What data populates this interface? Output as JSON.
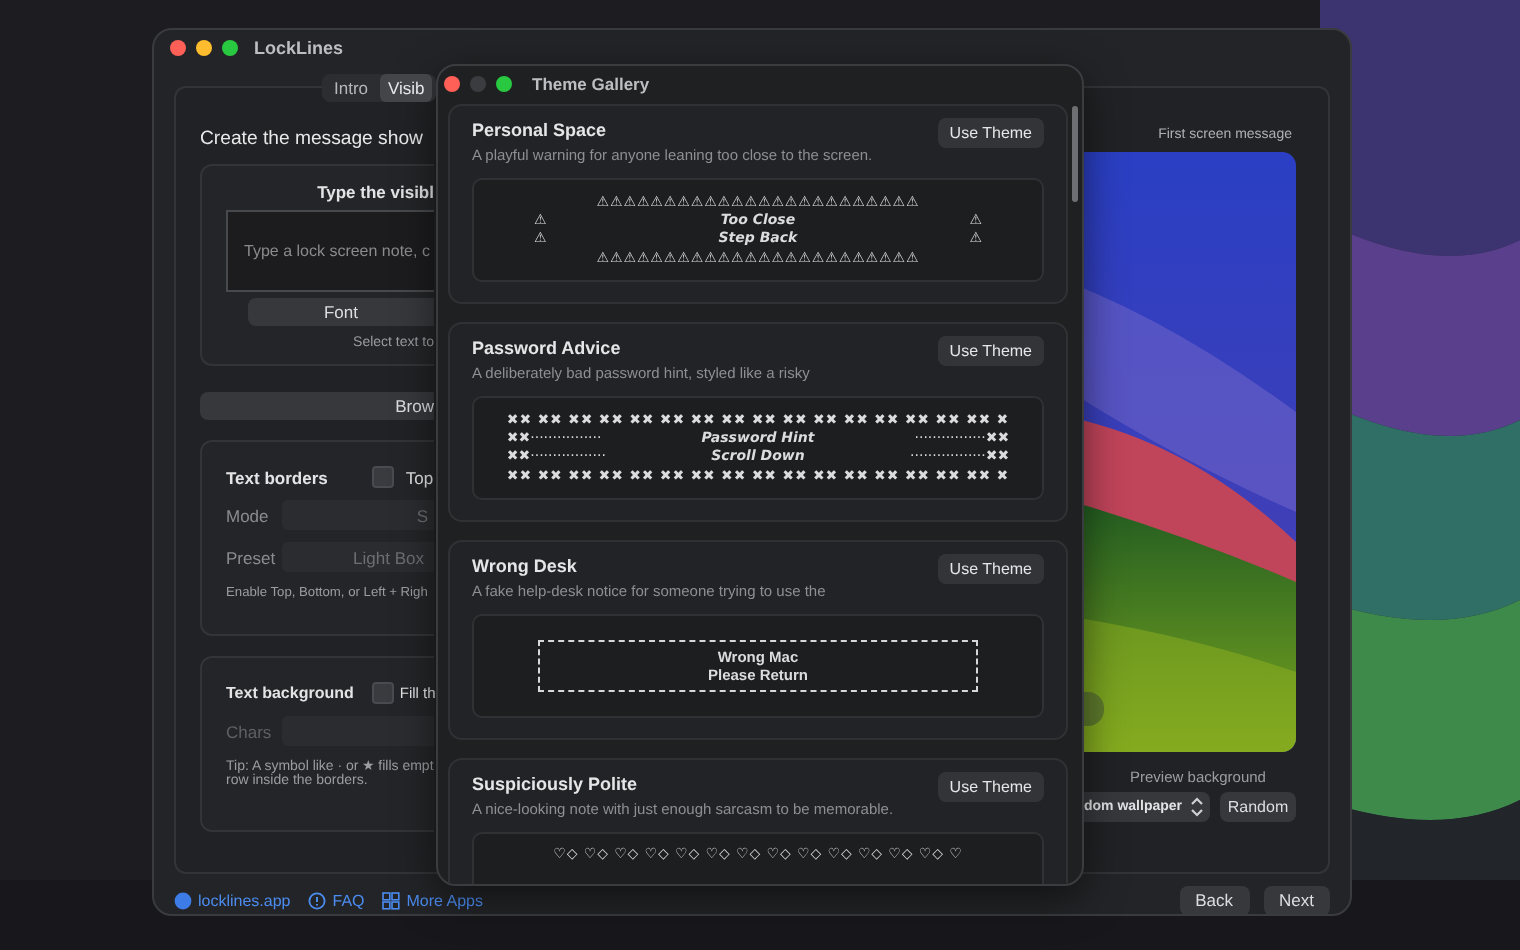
{
  "main_window": {
    "title": "LockLines",
    "tabs": [
      {
        "label": "Intro",
        "selected": false
      },
      {
        "label": "Visib",
        "selected": true
      }
    ],
    "heading": "Create the message show",
    "message_card": {
      "title": "Type the visibl",
      "placeholder": "Type a lock screen note, c",
      "font_button": "Font",
      "hint": "Select text to"
    },
    "browse_button": "Brow",
    "borders_card": {
      "title": "Text borders",
      "checkbox": {
        "label": "Top",
        "checked": false
      },
      "mode_label": "Mode",
      "mode_value": "S",
      "preset_label": "Preset",
      "preset_value": "Light Box",
      "hint": "Enable Top, Bottom, or Left + Righ"
    },
    "background_card": {
      "title": "Text background",
      "checkbox": {
        "label": "Fill th",
        "checked": false
      },
      "chars_label": "Chars",
      "tip_lines": [
        "Tip: A symbol like · or ★ fills empt",
        "row inside the borders."
      ]
    },
    "footer_links": [
      {
        "label": "locklines.app",
        "kind": "globe"
      },
      {
        "label": "FAQ",
        "kind": "help"
      },
      {
        "label": "More Apps",
        "kind": "grid"
      }
    ],
    "preview": {
      "title": "First screen message",
      "background_label": "Preview background",
      "wallpaper_select": "dom wallpaper",
      "random_button": "Random"
    },
    "nav_buttons": [
      "Back",
      "Next"
    ]
  },
  "gallery": {
    "title": "Theme Gallery",
    "themes": [
      {
        "name": "Personal Space",
        "description": "A playful warning for anyone leaning too close to the screen.",
        "button": "Use Theme",
        "preview": {
          "kind": "frame",
          "rows": [
            {
              "fill": "⚠⚠⚠⚠⚠⚠⚠⚠⚠⚠⚠⚠⚠⚠⚠⚠⚠⚠⚠⚠⚠⚠⚠⚠"
            },
            {
              "left": "⚠",
              "text": "Too Close",
              "right": "⚠"
            },
            {
              "left": "⚠",
              "text": "Step Back",
              "right": "⚠"
            },
            {
              "fill": "⚠⚠⚠⚠⚠⚠⚠⚠⚠⚠⚠⚠⚠⚠⚠⚠⚠⚠⚠⚠⚠⚠⚠⚠"
            }
          ]
        }
      },
      {
        "name": "Password Advice",
        "description": "A deliberately bad password hint, styled like a risky",
        "button": "Use Theme",
        "preview": {
          "kind": "frame",
          "rows": [
            {
              "fill": "✖✖ ✖✖ ✖✖ ✖✖ ✖✖ ✖✖ ✖✖ ✖✖ ✖✖ ✖✖ ✖✖ ✖✖ ✖✖ ✖✖ ✖✖ ✖✖ ✖"
            },
            {
              "left": "✖✖················",
              "text": "Password Hint",
              "right": "················✖✖"
            },
            {
              "left": "✖✖·················",
              "text": "Scroll Down",
              "right": "·················✖✖"
            },
            {
              "fill": "✖✖ ✖✖ ✖✖ ✖✖ ✖✖ ✖✖ ✖✖ ✖✖ ✖✖ ✖✖ ✖✖ ✖✖ ✖✖ ✖✖ ✖✖ ✖✖ ✖"
            }
          ]
        }
      },
      {
        "name": "Wrong Desk",
        "description": "A fake help-desk notice for someone trying to use the",
        "button": "Use Theme",
        "preview": {
          "kind": "dashed",
          "lines": [
            "Wrong Mac",
            "Please Return"
          ]
        }
      },
      {
        "name": "Suspiciously Polite",
        "description": "A nice-looking note with just enough sarcasm to be memorable.",
        "button": "Use Theme",
        "preview": {
          "kind": "frame",
          "rows": [
            {
              "fill": "♡◇ ♡◇ ♡◇ ♡◇ ♡◇ ♡◇ ♡◇ ♡◇ ♡◇ ♡◇ ♡◇ ♡◇ ♡◇ ♡"
            }
          ]
        }
      }
    ]
  }
}
